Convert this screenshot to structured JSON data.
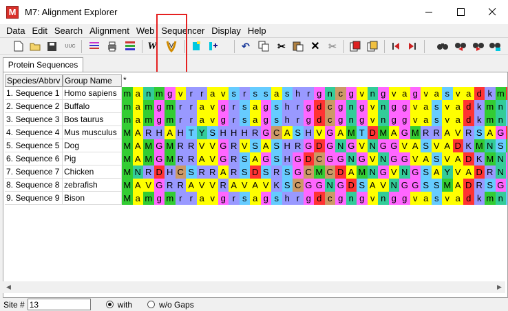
{
  "window": {
    "title": "M7: Alignment Explorer",
    "app_icon": "M"
  },
  "menu": [
    "Data",
    "Edit",
    "Search",
    "Alignment",
    "Web",
    "Sequencer",
    "Display",
    "Help"
  ],
  "toolbar_icons": [
    "new-file-icon",
    "open-folder-icon",
    "save-icon",
    "translate-icon",
    "highlight-color-icon",
    "print-icon",
    "aligner-icon",
    "muscle-icon",
    "align-w-icon",
    "align-m-icon",
    "insert-blank-icon",
    "insert-sequence-icon",
    "undo-icon",
    "copy-icon",
    "cut-icon",
    "paste-icon",
    "delete-icon",
    "delete-gap-icon",
    "mark-site-icon",
    "unmark-site-icon",
    "prev-site-icon",
    "next-site-icon",
    "find-icon",
    "find-prev-icon",
    "find-next-icon",
    "find-motif-icon"
  ],
  "toolbar_labels": {
    "align_w": "W",
    "translate": "UUC"
  },
  "tabs": [
    {
      "label": "Protein Sequences"
    }
  ],
  "grid": {
    "headers": {
      "species": "Species/Abbrv",
      "group": "Group Name",
      "consensus": "*"
    },
    "rows": [
      {
        "species": "1. Sequence 1",
        "group": "Homo sapiens",
        "seq": "manmgvrravsrssashrgncgvngvagvasvadkmdsmvakn"
      },
      {
        "species": "2. Sequence 2",
        "group": "Buffalo",
        "seq": "mamgmrravgrsagshrgdcgngvnggvasvadkmnsmvakks"
      },
      {
        "species": "3. Sequence 3",
        "group": "Bos taurus",
        "seq": "mamgmrravgrsagshrgdcgngvnggvasvadkmnsmvakks"
      },
      {
        "species": "4. Sequence 4",
        "group": "Mus musculus",
        "seq": "MARHAHTYSHHHRGCASHVGAMTDMAGMRRAVRSAGDGRGCGV"
      },
      {
        "species": "5. Sequence 5",
        "group": "Dog",
        "seq": "MAMGMRRVVGRVSASHRGDGNGVNGGVASVADKMNSMVAKKSR"
      },
      {
        "species": "6. Sequence 6",
        "group": "Pig",
        "seq": "MAMGMRRAVGRSAGSHGDCGGNGVNGGVASVADKMNGMVAKKS"
      },
      {
        "species": "7. Sequence 7",
        "group": "Chicken",
        "seq": "MNRDHCSRRARSDSRSGCMCDAMNGVNGSAYVADRNGSVARYS"
      },
      {
        "species": "8. Sequence 8",
        "group": "zebrafish",
        "seq": "MAVGRRAVVRAVAVKSCGGNGDSAVNGGSSMADRSGSVSYVSS"
      },
      {
        "species": "9. Sequence 9",
        "group": "Bison",
        "seq": "Mamgmrravgrsagshrgdcgngvnggvasvadkmnsmvakks"
      }
    ]
  },
  "aa_colors": {
    "a": "#ffff00",
    "v": "#ffff00",
    "l": "#ffff00",
    "i": "#ffff00",
    "m": "#33cc33",
    "g": "#ff66ff",
    "r": "#9999ff",
    "k": "#9999ff",
    "h": "#9999ff",
    "s": "#66ccff",
    "t": "#66ccff",
    "n": "#33cc99",
    "q": "#33cc99",
    "d": "#ff3333",
    "e": "#ff3333",
    "c": "#cc9966",
    "y": "#33cc99",
    "f": "#66ff66",
    "w": "#66ff66",
    "p": "#ff9900"
  },
  "status": {
    "site_label": "Site #",
    "site_value": "13",
    "with_gaps": "with",
    "without_gaps": "w/o Gaps"
  },
  "accent": {
    "highlight_box": "#e52020"
  }
}
